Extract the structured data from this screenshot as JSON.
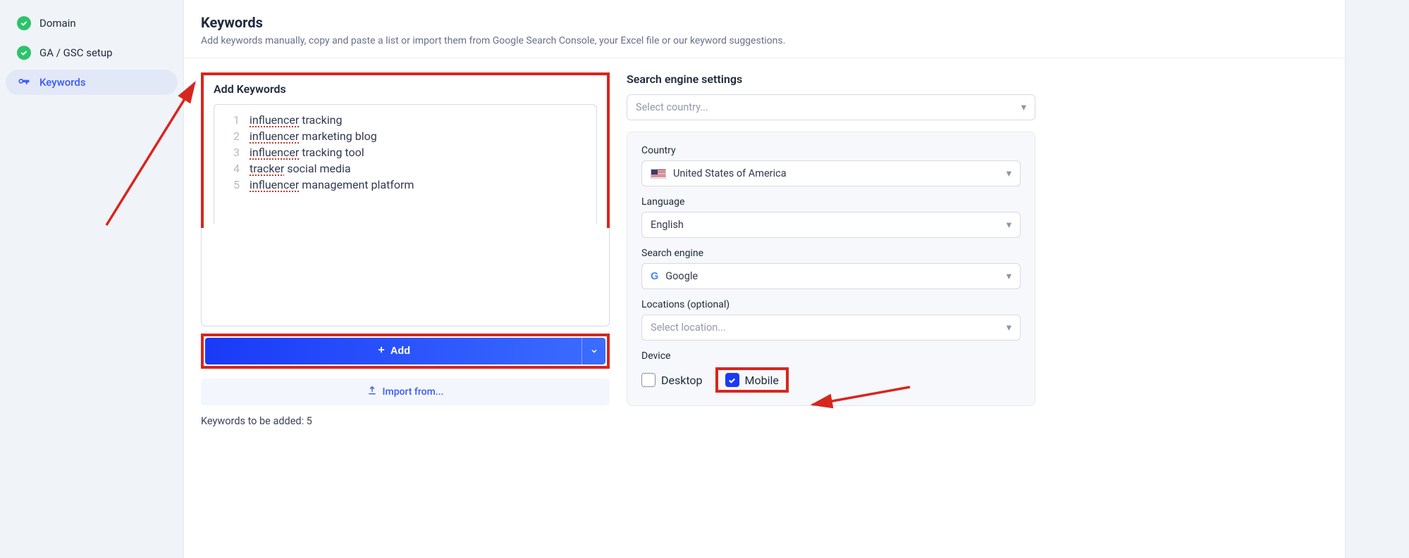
{
  "sidebar": {
    "items": [
      {
        "label": "Domain",
        "status": "done"
      },
      {
        "label": "GA / GSC setup",
        "status": "done"
      },
      {
        "label": "Keywords",
        "status": "active"
      }
    ]
  },
  "header": {
    "title": "Keywords",
    "subtitle": "Add keywords manually, copy and paste a list or import them from Google Search Console, your Excel file or our keyword suggestions."
  },
  "add_keywords": {
    "heading": "Add Keywords",
    "rows": [
      {
        "n": "1",
        "a": "influencer",
        "b": " tracking"
      },
      {
        "n": "2",
        "a": "influencer",
        "b": " marketing blog"
      },
      {
        "n": "3",
        "a": "influencer",
        "b": " tracking tool"
      },
      {
        "n": "4",
        "a": "tracker",
        "b": " social media"
      },
      {
        "n": "5",
        "a": "influencer",
        "b": " management platform"
      }
    ],
    "add_label": "Add",
    "import_label": "Import from...",
    "count_label": "Keywords to be added: 5"
  },
  "settings": {
    "heading": "Search engine settings",
    "country_top_ph": "Select country...",
    "country_label": "Country",
    "country_value": "United States of America",
    "language_label": "Language",
    "language_value": "English",
    "engine_label": "Search engine",
    "engine_value": "Google",
    "locations_label": "Locations (optional)",
    "locations_ph": "Select location...",
    "device_label": "Device",
    "device_desktop": "Desktop",
    "device_mobile": "Mobile"
  }
}
